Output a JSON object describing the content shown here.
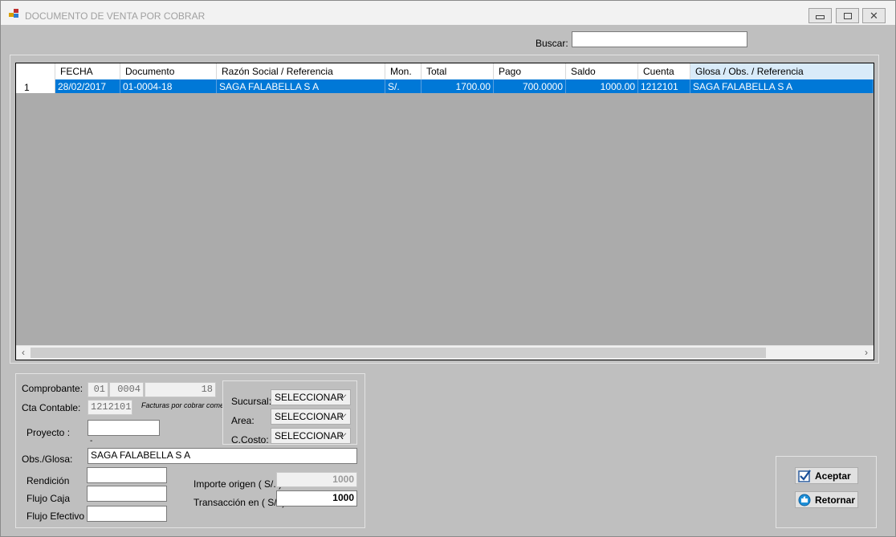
{
  "window": {
    "title": "DOCUMENTO DE VENTA POR COBRAR"
  },
  "search": {
    "label": "Buscar:",
    "value": ""
  },
  "grid": {
    "columns": [
      "FECHA",
      "Documento",
      "Razón Social / Referencia",
      "Mon.",
      "Total",
      "Pago",
      "Saldo",
      "Cuenta",
      "Glosa / Obs. / Referencia"
    ],
    "rows": [
      {
        "num": "1",
        "fecha": "28/02/2017",
        "documento": "01-0004-18",
        "razon": "SAGA FALABELLA S A",
        "mon": "S/.",
        "total": "1700.00",
        "pago": "700.0000",
        "saldo": "1000.00",
        "cuenta": "1212101",
        "glosa": "SAGA FALABELLA S A"
      }
    ]
  },
  "form": {
    "comprobante_label": "Comprobante:",
    "comprobante_tipo": "01",
    "comprobante_serie": "0004",
    "comprobante_numero": "18",
    "cta_label": "Cta Contable:",
    "cta_value": "1212101",
    "cta_desc": "Facturas por cobrar come",
    "proyecto_label": "Proyecto :",
    "proyecto_value": "",
    "proyecto_note": "-",
    "sucursal_label": "Sucursal:",
    "sucursal_value": "SELECCIONAR",
    "area_label": "Area:",
    "area_value": "SELECCIONAR",
    "ccosto_label": "C.Costo:",
    "ccosto_value": "SELECCIONAR",
    "obs_label": "Obs./Glosa:",
    "obs_value": "SAGA FALABELLA S A",
    "rendicion_label": "Rendición",
    "flujo_caja_label": "Flujo Caja",
    "flujo_efectivo_label": "Flujo Efectivo",
    "importe_label": "Importe origen ( S/. )",
    "importe_value": "1000",
    "transaccion_label": "Transacción en ( S/. )",
    "transaccion_value": "1000"
  },
  "buttons": {
    "aceptar": "Aceptar",
    "retornar": "Retornar"
  },
  "colors": {
    "selection": "#0078d7",
    "client_bg": "#c0c0c0",
    "grid_bg": "#ababab"
  }
}
